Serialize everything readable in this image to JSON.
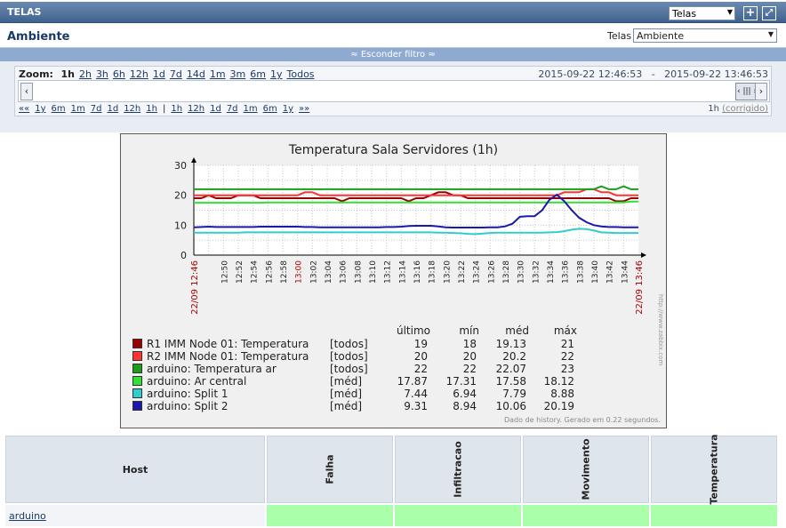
{
  "header": {
    "title": "TELAS",
    "select_value": "Telas"
  },
  "screen": {
    "name": "Ambiente",
    "label": "Telas",
    "select_value": "Ambiente"
  },
  "filter": {
    "toggle_label": "Esconder filtro"
  },
  "zoom": {
    "label": "Zoom:",
    "options": [
      "1h",
      "2h",
      "3h",
      "6h",
      "12h",
      "1d",
      "7d",
      "14d",
      "1m",
      "3m",
      "6m",
      "1y",
      "Todos"
    ],
    "active": "1h",
    "from": "2015-09-22 12:46:53",
    "separator": "-",
    "to": "2015-09-22 13:46:53",
    "nav_back": [
      "««",
      "1y",
      "6m",
      "1m",
      "7d",
      "1d",
      "12h",
      "1h"
    ],
    "nav_sep": "|",
    "nav_forward": [
      "1h",
      "12h",
      "1d",
      "7d",
      "1m",
      "6m",
      "1y",
      "»»"
    ],
    "period": "1h",
    "fixed_label": "(corrigido)"
  },
  "graph": {
    "title": "Temperatura Sala Servidores (1h)",
    "footer": "Dado de history. Gerado em 0.22 segundos.",
    "watermark": "http://www.zabbix.com",
    "legend_headers": [
      "último",
      "mín",
      "méd",
      "máx"
    ],
    "legend": [
      {
        "name": "R1 IMM Node 01: Temperatura",
        "fn": "[todos]",
        "last": "19",
        "min": "18",
        "avg": "19.13",
        "max": "21",
        "color": "#990000"
      },
      {
        "name": "R2 IMM Node 01: Temperatura",
        "fn": "[todos]",
        "last": "20",
        "min": "20",
        "avg": "20.2",
        "max": "22",
        "color": "#ff3333"
      },
      {
        "name": "arduino: Temperatura ar",
        "fn": "[todos]",
        "last": "22",
        "min": "22",
        "avg": "22.07",
        "max": "23",
        "color": "#1a9e1a"
      },
      {
        "name": "arduino: Ar central",
        "fn": "[méd]",
        "last": "17.87",
        "min": "17.31",
        "avg": "17.58",
        "max": "18.12",
        "color": "#33e033"
      },
      {
        "name": "arduino: Split 1",
        "fn": "[méd]",
        "last": "7.44",
        "min": "6.94",
        "avg": "7.79",
        "max": "8.88",
        "color": "#33cccc"
      },
      {
        "name": "arduino: Split 2",
        "fn": "[méd]",
        "last": "9.31",
        "min": "8.94",
        "avg": "10.06",
        "max": "20.19",
        "color": "#1a1aaa"
      }
    ]
  },
  "chart_data": {
    "type": "line",
    "title": "Temperatura Sala Servidores (1h)",
    "ylim": [
      0,
      30
    ],
    "yticks": [
      "0",
      "10",
      "20",
      "30"
    ],
    "x_start_label": "22/09 12:46",
    "x_end_label": "22/09 13:46",
    "x_ticks": [
      "12:50",
      "12:52",
      "12:54",
      "12:56",
      "12:58",
      "13:00",
      "13:02",
      "13:04",
      "13:06",
      "13:08",
      "13:10",
      "13:12",
      "13:14",
      "13:16",
      "13:18",
      "13:20",
      "13:22",
      "13:24",
      "13:26",
      "13:28",
      "13:30",
      "13:32",
      "13:34",
      "13:36",
      "13:38",
      "13:40",
      "13:42",
      "13:44"
    ],
    "x_minutes": [
      0,
      2,
      4,
      6,
      8,
      10,
      12,
      14,
      16,
      18,
      20,
      22,
      24,
      26,
      28,
      30,
      32,
      34,
      36,
      38,
      40,
      42,
      44,
      46,
      48,
      50,
      52,
      54,
      56,
      58,
      60
    ],
    "series": [
      {
        "name": "R1 IMM Node 01: Temperatura",
        "color": "#990000",
        "values": [
          19,
          19,
          20,
          19,
          19,
          19,
          20,
          20,
          20,
          19,
          19,
          19,
          19,
          19,
          19,
          19,
          19,
          19,
          19,
          19,
          18,
          19,
          19,
          19,
          19,
          19,
          19,
          19,
          19,
          18,
          19,
          19,
          20,
          21,
          21,
          20,
          20,
          19,
          19,
          19,
          19,
          19,
          19,
          19,
          19,
          19,
          19,
          19,
          19,
          19,
          19,
          19,
          19,
          19,
          19,
          19,
          19,
          18,
          18,
          19,
          19
        ]
      },
      {
        "name": "R2 IMM Node 01: Temperatura",
        "color": "#ff3333",
        "values": [
          20,
          20,
          20,
          20,
          20,
          20,
          20,
          20,
          20,
          20,
          20,
          20,
          20,
          20,
          20,
          21,
          21,
          20,
          20,
          20,
          20,
          20,
          20,
          20,
          20,
          20,
          20,
          20,
          20,
          20,
          20,
          20,
          20,
          20,
          20,
          20,
          20,
          20,
          20,
          20,
          20,
          20,
          20,
          20,
          20,
          20,
          20,
          20,
          20,
          20,
          21,
          21,
          21,
          22,
          22,
          21,
          21,
          20,
          20,
          20,
          20
        ]
      },
      {
        "name": "arduino: Temperatura ar",
        "color": "#1a9e1a",
        "values": [
          22,
          22,
          22,
          22,
          22,
          22,
          22,
          22,
          22,
          22,
          22,
          22,
          22,
          22,
          22,
          22,
          22,
          22,
          22,
          22,
          22,
          22,
          22,
          22,
          22,
          22,
          22,
          22,
          22,
          22,
          22,
          22,
          22,
          22,
          22,
          22,
          22,
          22,
          22,
          22,
          22,
          22,
          22,
          22,
          22,
          22,
          22,
          22,
          22,
          22,
          22,
          22,
          22,
          22,
          22,
          23,
          22,
          22,
          23,
          22,
          22
        ]
      },
      {
        "name": "arduino: Ar central",
        "color": "#33e033",
        "values": [
          17.5,
          17.5,
          17.5,
          17.5,
          17.5,
          17.5,
          17.5,
          17.5,
          17.5,
          17.5,
          17.6,
          17.6,
          17.6,
          17.6,
          17.6,
          17.6,
          17.6,
          17.6,
          17.6,
          17.6,
          17.6,
          17.6,
          17.6,
          17.6,
          17.6,
          17.6,
          17.6,
          17.6,
          17.6,
          17.6,
          17.6,
          17.6,
          17.6,
          17.6,
          17.6,
          17.6,
          17.6,
          17.6,
          17.6,
          17.6,
          17.6,
          17.6,
          17.6,
          17.6,
          17.6,
          17.6,
          17.6,
          17.6,
          17.6,
          17.6,
          17.6,
          17.6,
          17.6,
          17.6,
          17.6,
          17.6,
          17.6,
          17.6,
          17.6,
          17.9,
          17.9
        ]
      },
      {
        "name": "arduino: Split 1",
        "color": "#33cccc",
        "values": [
          7.5,
          7.5,
          7.5,
          7.5,
          7.5,
          7.5,
          7.5,
          7.6,
          7.6,
          7.6,
          7.6,
          7.6,
          7.6,
          7.6,
          7.6,
          7.6,
          7.6,
          7.6,
          7.6,
          7.6,
          7.6,
          7.6,
          7.6,
          7.6,
          7.6,
          7.6,
          7.6,
          7.6,
          7.6,
          7.6,
          7.6,
          7.6,
          7.6,
          7.5,
          7.5,
          7.4,
          7.3,
          7.1,
          7.0,
          7.2,
          7.4,
          7.5,
          7.5,
          7.5,
          7.5,
          7.5,
          7.5,
          7.5,
          7.6,
          7.7,
          8.0,
          8.5,
          8.8,
          8.7,
          8.2,
          7.6,
          7.5,
          7.4,
          7.4,
          7.4,
          7.4
        ]
      },
      {
        "name": "arduino: Split 2",
        "color": "#1a1aaa",
        "values": [
          9.3,
          9.4,
          9.5,
          9.4,
          9.4,
          9.4,
          9.4,
          9.4,
          9.4,
          9.5,
          9.5,
          9.5,
          9.5,
          9.5,
          9.5,
          9.4,
          9.4,
          9.3,
          9.3,
          9.3,
          9.3,
          9.3,
          9.3,
          9.3,
          9.3,
          9.3,
          9.4,
          9.4,
          9.5,
          9.7,
          9.8,
          9.8,
          9.8,
          9.6,
          9.3,
          9.2,
          9.2,
          9.2,
          9.2,
          9.2,
          9.3,
          9.3,
          9.6,
          10.5,
          12.8,
          13.0,
          13.0,
          15.0,
          18.5,
          20.19,
          18.0,
          15.0,
          12.5,
          11.0,
          10.0,
          9.6,
          9.4,
          9.4,
          9.3,
          9.3,
          9.3
        ]
      }
    ]
  },
  "hosts_table": {
    "host_header": "Host",
    "columns": [
      "Falha",
      "Infiltracao",
      "Movimento",
      "Temperatura"
    ],
    "rows": [
      {
        "host": "arduino"
      }
    ]
  }
}
